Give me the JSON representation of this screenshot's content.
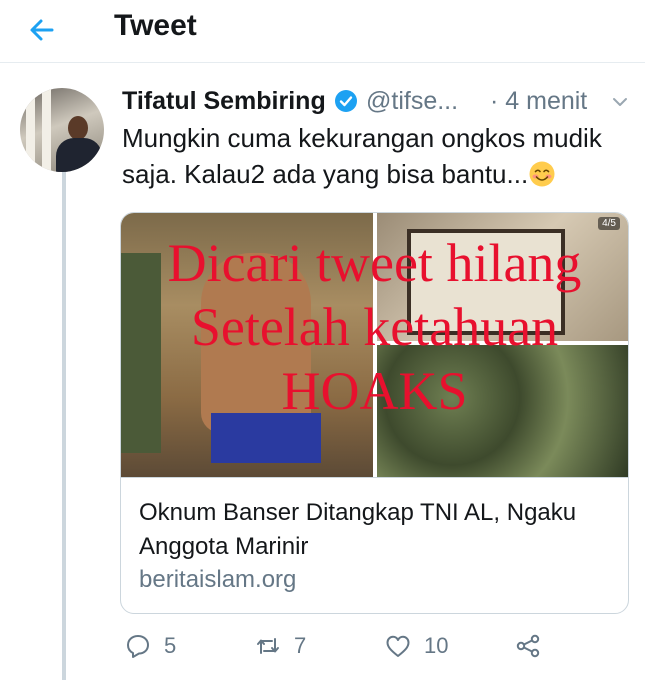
{
  "header": {
    "title": "Tweet",
    "back_icon": "arrow-left-icon",
    "accent_color": "#1da1f2"
  },
  "tweet": {
    "author_name": "Tifatul Sembiring",
    "handle": "@tifse...",
    "timestamp": "· 4 menit",
    "verified": true,
    "text": "Mungkin cuma kekurangan ongkos mudik\nsaja. Kalau2 ada yang bisa bantu...",
    "emoji": "smiling-face-icon",
    "card": {
      "media_counter": "4/5",
      "overlay_text": "Dicari tweet hilang\nSetelah ketahuan\nHOAKS",
      "title": "Oknum Banser Ditangkap TNI AL, Ngaku Anggota Marinir",
      "domain": "beritaislam.org"
    },
    "actions": {
      "replies": "5",
      "retweets": "7",
      "likes": "10"
    }
  },
  "colors": {
    "text": "#14171a",
    "secondary": "#657786",
    "border": "#ccd6dd",
    "overlay_red": "#e8102e"
  }
}
